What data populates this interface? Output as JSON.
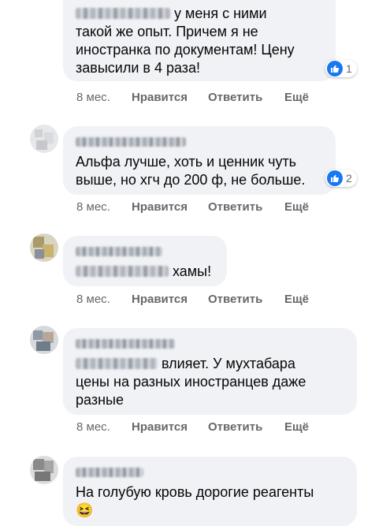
{
  "actions": {
    "time": "8 мес.",
    "like": "Нравится",
    "reply": "Ответить",
    "more": "Ещё"
  },
  "comments": [
    {
      "lines": [
        "у меня с ними",
        "такой же опыт. Причем я не",
        "иностранка по документам! Цену",
        "завысили в 4 раза!"
      ],
      "reactions": "1"
    },
    {
      "lines": [
        "Альфа лучше, хоть и ценник чуть",
        "выше, но хгч до 200 ф, не больше."
      ],
      "reactions": "2"
    },
    {
      "lines": [
        "хамы!"
      ]
    },
    {
      "lines": [
        "влияет. У мухтабара",
        "цены на разных иностранцев даже",
        "разные"
      ]
    },
    {
      "lines": [
        "На голубую кровь дорогие реагенты"
      ],
      "emoji": "😆"
    }
  ],
  "colors": {
    "bubble": "#f0f2f5",
    "secondary_text": "#65676b",
    "like_blue": "#1877f2"
  }
}
